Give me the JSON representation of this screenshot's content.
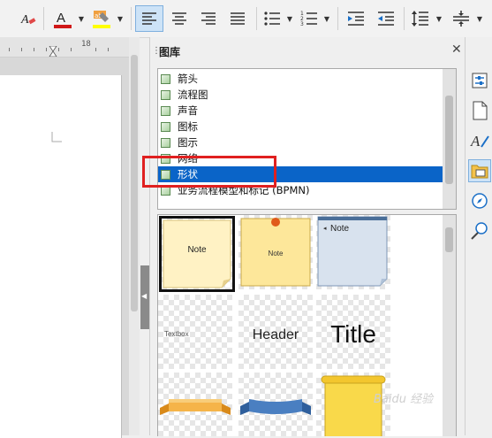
{
  "gallery": {
    "title": "图库",
    "themes": [
      {
        "label": "箭头"
      },
      {
        "label": "流程图"
      },
      {
        "label": "声音"
      },
      {
        "label": "图标"
      },
      {
        "label": "图示"
      },
      {
        "label": "网络"
      },
      {
        "label": "形状",
        "selected": true
      },
      {
        "label": "业务流程模型和标记 (BPMN)"
      }
    ],
    "items": [
      {
        "name": "note-yellow",
        "text": "Note"
      },
      {
        "name": "note-pinned",
        "text": "Note"
      },
      {
        "name": "note-blue",
        "text": "Note"
      },
      {
        "name": "textbox",
        "text": "Textbox"
      },
      {
        "name": "header",
        "text": "Header"
      },
      {
        "name": "title",
        "text": "Title"
      },
      {
        "name": "ribbon-orange",
        "text": ""
      },
      {
        "name": "ribbon-blue",
        "text": ""
      },
      {
        "name": "scroll-yellow",
        "text": ""
      }
    ]
  },
  "ruler": {
    "label": "18"
  },
  "colors": {
    "font_color": "#d01818",
    "highlight_color": "#ffff00",
    "selection": "#0a64c8",
    "annotation": "#e02020"
  },
  "watermark": "Baidu 经验"
}
